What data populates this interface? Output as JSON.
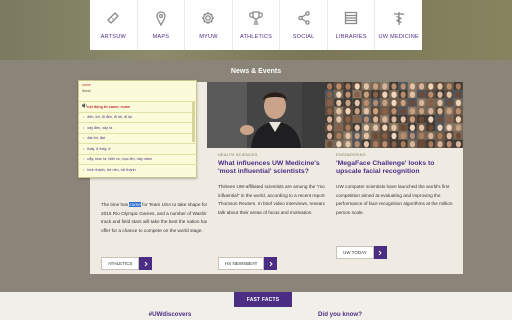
{
  "quicknav": [
    {
      "label": "ARTSUW",
      "icon": "ticket-icon"
    },
    {
      "label": "MAPS",
      "icon": "map-pin-icon"
    },
    {
      "label": "MYUW",
      "icon": "gear-icon"
    },
    {
      "label": "ATHLETICS",
      "icon": "trophy-icon"
    },
    {
      "label": "SOCIAL",
      "icon": "share-icon"
    },
    {
      "label": "LIBRARIES",
      "icon": "books-icon"
    },
    {
      "label": "UW MEDICINE",
      "icon": "caduceus-icon"
    }
  ],
  "news": {
    "heading": "News & Events",
    "cards": [
      {
        "body_before": "The time has ",
        "body_selected": "come",
        "body_after": " for Team USA to take shape for the 2016 Rio Olympic Games, and a number of Washington track and field stars will take the best the nation has to offer for a chance to compete on the world stage.",
        "button": "ATHLETICS"
      },
      {
        "category": "HEALTH SCIENCES",
        "title": "What influences UW Medicine's 'most influential' scientists?",
        "body": "Thirteen UW-affiliated scientists are among the \"most influential\" in the world, according to a recent report by Thomson Reuters. In brief video interviews, researchers talk about their areas of focus and motivation.",
        "button": "HS NEWSBEAT"
      },
      {
        "category": "ENGINEERING",
        "title": "'MegaFace Challenge' looks to upscale facial recognition",
        "body": "UW computer scientists have launched the world's first competition aimed at evaluating and improving the performance of face recognition algorithms at the million person scale.",
        "button": "UW TODAY"
      }
    ]
  },
  "popup": {
    "word": "came",
    "pron": "/kʌm/",
    "rows": [
      "nội động từ came; come",
      "đến, tới, đi đến, đi tới, đi lại",
      "xảy đến, xảy ra",
      "đạt tới, đạt",
      "thấy, ở thấy, ở",
      "nẩy, mọc ra, hiện ra, mọc lên, nảy mầm",
      "hình thành, trở nên, trở thành"
    ]
  },
  "bottom": {
    "fast_facts": "FAST FACTS",
    "uwdiscovers": "#UWdiscovers",
    "did_you_know": "Did you know?"
  },
  "colors": {
    "purple": "#4b2e83",
    "gold": "#85754d",
    "bg": "#8a8578"
  }
}
